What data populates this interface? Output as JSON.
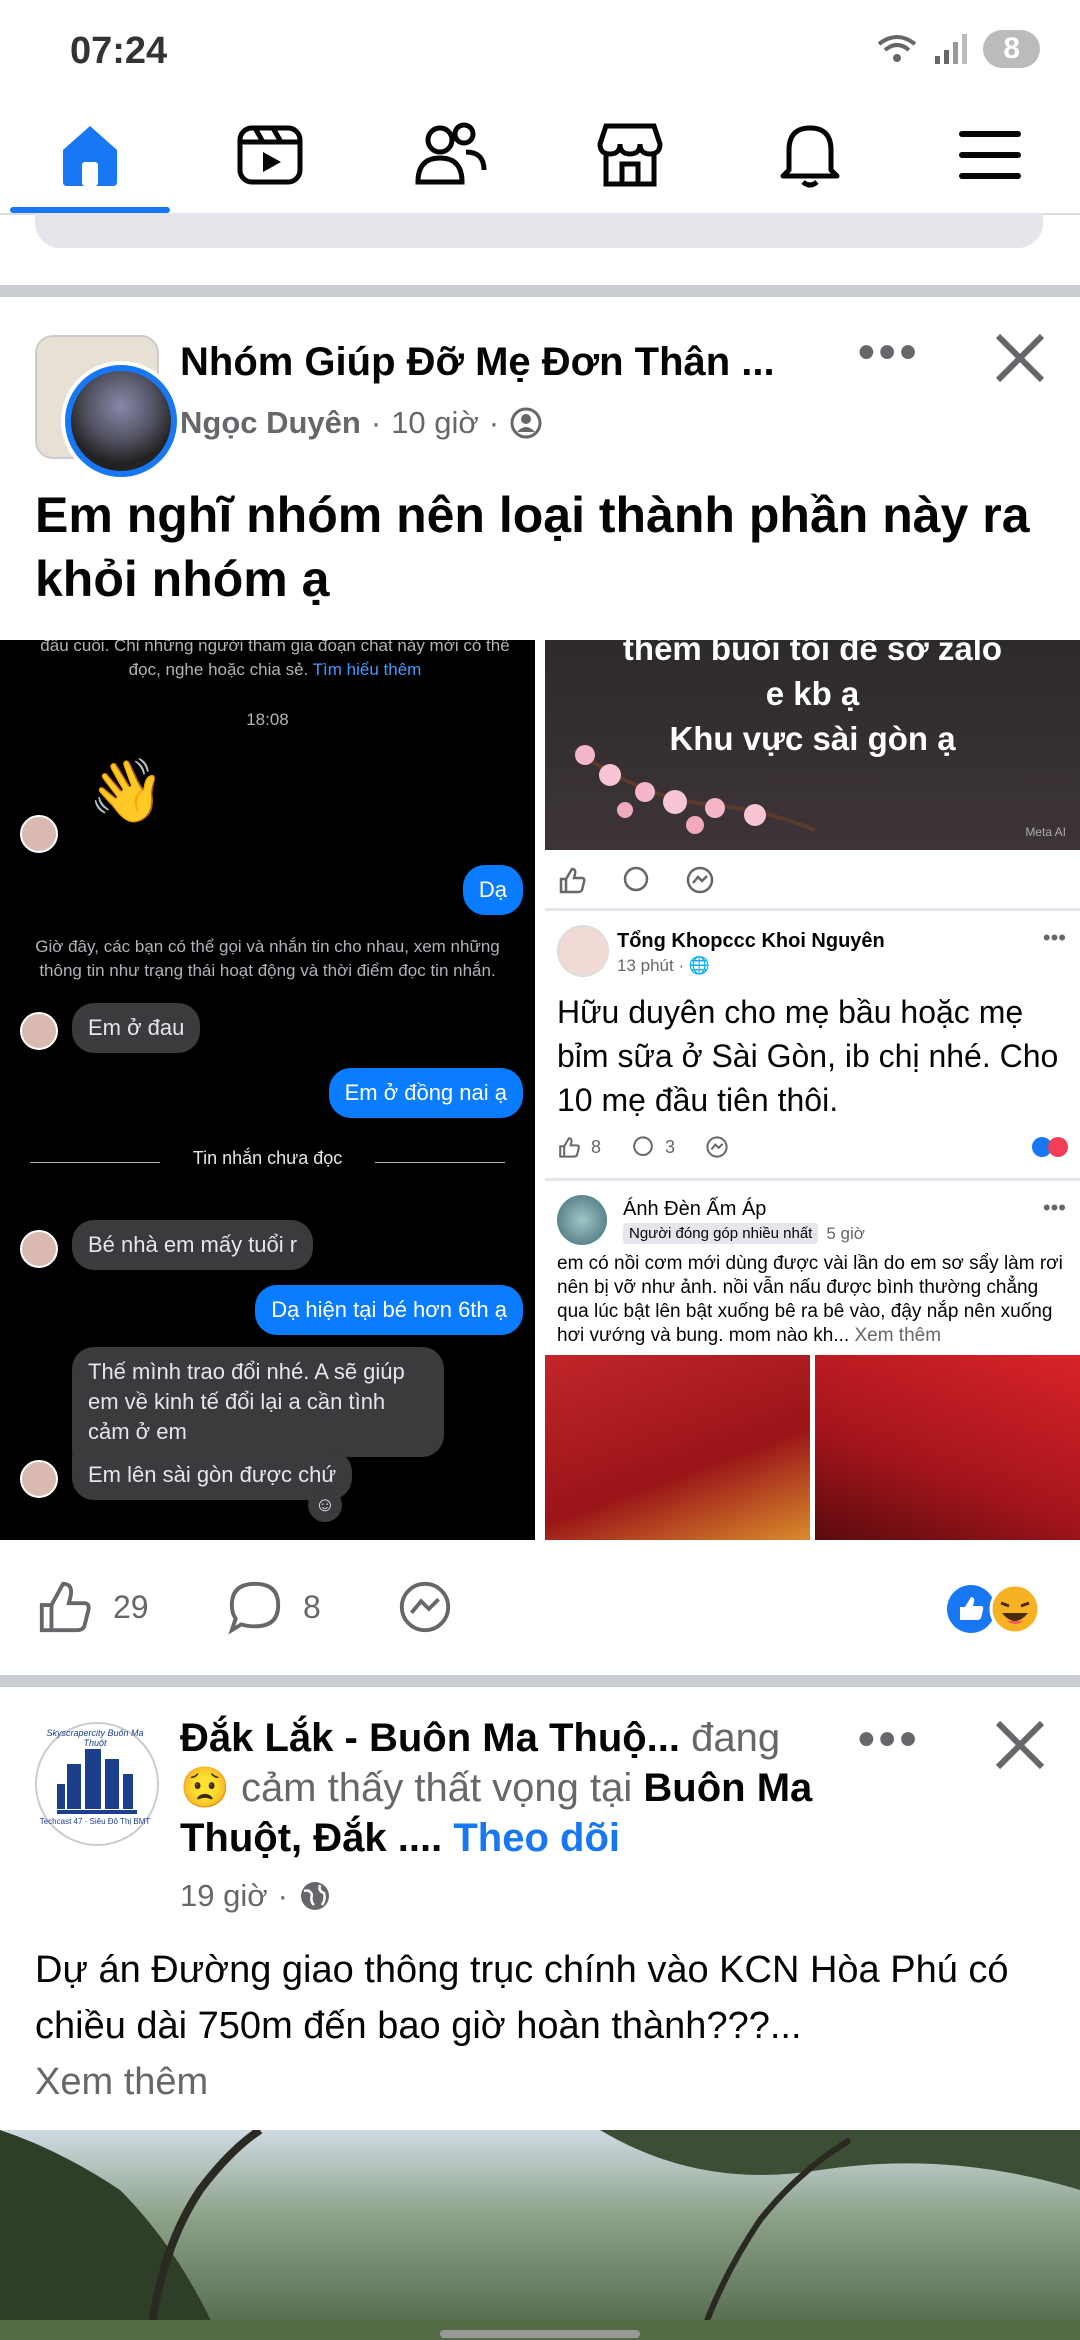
{
  "status_bar": {
    "time": "07:24",
    "battery": "8"
  },
  "nav": {
    "items": [
      "home-icon",
      "video-icon",
      "friends-icon",
      "marketplace-icon",
      "notifications-icon",
      "menu-icon"
    ],
    "active": "home",
    "accent": "#1877f2"
  },
  "post1": {
    "group_name": "Nhóm Giúp Đỡ Mẹ Đơn Thân ...",
    "author": "Ngọc Duyên",
    "time": "10 giờ",
    "text": "Em nghĩ nhóm nên loại thành phần này ra khỏi nhóm ạ",
    "chat": {
      "notice": "đấu cuối. Chỉ những người tham gia đoạn chat này mới có thể đọc, nghe hoặc chia sẻ.",
      "notice_link": "Tìm hiểu thêm",
      "time": "18:08",
      "wave": "👋",
      "msg_da": "Dạ",
      "info": "Giờ đây, các bạn có thể gọi và nhắn tin cho nhau, xem những thông tin như trạng thái hoạt động và thời điểm đọc tin nhắn.",
      "msg1": "Em ở đau",
      "msg2": "Em ở đồng nai ạ",
      "unread": "Tin nhắn chưa đọc",
      "msg3": "Bé nhà em mấy tuổi r",
      "msg4": "Dạ hiện tại bé hơn 6th ạ",
      "msg5": "Thế mình trao đổi nhé. A sẽ giúp em về kinh tế đổi lại a cần tình cảm ở em",
      "msg6": "Em lên sài gòn được chứ"
    },
    "right": {
      "img_text1": "thêm buổi tối để sờ zalo",
      "img_text2": "e kb ạ",
      "img_text3": "Khu vực sài gòn ạ",
      "img_credit": "Meta AI",
      "p2_author": "Tổng Khopccc Khoi Nguyên",
      "p2_time": "13 phút",
      "p2_text": "Hữu duyên cho mẹ bầu hoặc mẹ bỉm sữa ở Sài Gòn, ib chị nhé. Cho 10 mẹ đầu tiên thôi.",
      "p2_likes": "8",
      "p2_comments": "3",
      "p3_author": "Ánh Đèn Ấm Áp",
      "p3_badge": "Người đóng góp nhiều nhất",
      "p3_time": "5 giờ",
      "p3_text": "em có nồi cơm mới dùng được vài lần do em sơ sẩy làm rơi nên bị vỡ như ảnh. nồi vẫn nấu được bình thường chẳng qua lúc bật lên bật xuống bê ra bê vào, đậy nắp nên xuống hơi vướng và bung. mom nào kh...",
      "p3_more": "Xem thêm"
    },
    "likes": "29",
    "comments": "8"
  },
  "post2": {
    "page_name": "Đắk Lắk - Buôn Ma Thuộ...",
    "feeling_prefix": "đang",
    "feeling": "cảm thấy thất vọng tại",
    "place": "Buôn Ma Thuột, Đắk ....",
    "follow": "Theo dõi",
    "time": "19 giờ",
    "text": "Dự án Đường giao thông trục chính vào KCN Hòa Phú có chiều dài 750m đến bao giờ hoàn thành???...",
    "see_more": "Xem thêm",
    "logo_text_top": "Skyscrapercity Buôn Ma Thuột",
    "logo_text_bottom": "Techcast 47 · Siêu Đô Thị BMT"
  }
}
